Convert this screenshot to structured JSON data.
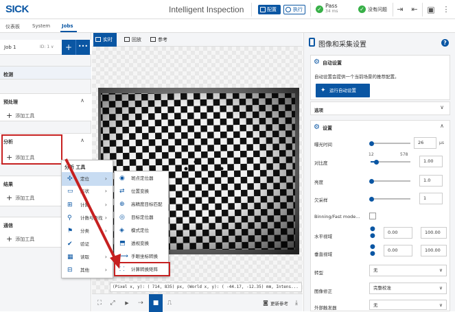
{
  "brand": {
    "logo": "SICK",
    "app_title": "Intelligent Inspection"
  },
  "toolbar": {
    "config_label": "配置",
    "run_label": "执行",
    "pass_label": "Pass",
    "pass_time": "34 ms",
    "issue_label": "没有问题"
  },
  "tabs": [
    "仪表板",
    "System",
    "Jobs"
  ],
  "job": {
    "name": "Job 1",
    "id_label": "ID: 1"
  },
  "sections": {
    "detect": "检测",
    "preprocess": "预处理",
    "analysis": "分析",
    "result": "结果",
    "comm": "通信",
    "add_tool": "添加工具"
  },
  "view": {
    "tabs": [
      "实时",
      "回放",
      "参考"
    ],
    "status_text": "(Pixel x, y): (   714,   835) px, (World x, y): (  -44.17,   -12.35) mm, Intens...",
    "update_ref": "更新参考"
  },
  "menu1": {
    "title": "分析 工具",
    "items": [
      "定位",
      "形状",
      "计算",
      "计数与查找",
      "分类",
      "验证",
      "读取",
      "其他"
    ]
  },
  "menu2": {
    "items": [
      "斑点定位器",
      "位置变换",
      "高精度目标匹配",
      "目标定位器",
      "模式定位",
      "透视变换",
      "手眼坐标转换",
      "计算转换矩阵"
    ]
  },
  "right": {
    "title": "图像和采集设置",
    "auto_title": "自动设置",
    "auto_desc": "自动设置会提供一个当前场景的推荐配置。",
    "auto_button": "运行自动设置",
    "options_title": "选项",
    "settings_title": "设置",
    "exposure": {
      "label": "曝光时间",
      "value": "26",
      "unit": "µs",
      "level": 0.03
    },
    "contrast": {
      "label": "对比度",
      "min": "12",
      "max": "578",
      "value": "1.00",
      "level": 0.14
    },
    "brightness": {
      "label": "亮度",
      "value": "1.0",
      "level": 0.03
    },
    "subsample": {
      "label": "欠采样",
      "value": "1",
      "level": 0.03
    },
    "binning": {
      "label": "Binning/Fast mode..."
    },
    "hfov": {
      "label": "水平视域",
      "min": "0.00",
      "max": "100.00"
    },
    "vfov": {
      "label": "垂直视域",
      "min": "0.00",
      "max": "100.00"
    },
    "rotate": {
      "label": "转型",
      "value": "无"
    },
    "correction": {
      "label": "图像修正",
      "value": "完整校准"
    },
    "trigger": {
      "label": "外部触发器",
      "value": "无"
    }
  },
  "colors": {
    "accent": "#0a56a3",
    "ok": "#38b048",
    "highlight": "#c62020"
  }
}
